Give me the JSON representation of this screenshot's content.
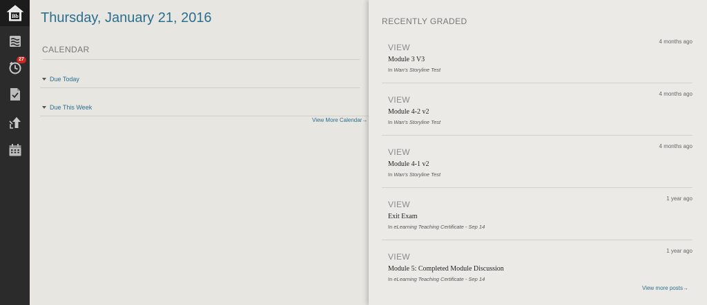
{
  "sidebar": {
    "badge_count": "27",
    "items": [
      {
        "icon": "blackboard-home-icon",
        "label": "Bb"
      },
      {
        "icon": "activity-stream-icon"
      },
      {
        "icon": "clock-icon"
      },
      {
        "icon": "grades-icon"
      },
      {
        "icon": "upload-icon"
      },
      {
        "icon": "calendar-icon"
      }
    ]
  },
  "left": {
    "date": "Thursday, January 21, 2016",
    "calendar_heading": "CALENDAR",
    "due_today": "Due Today",
    "due_this_week": "Due This Week",
    "view_more_calendar": "View More Calendar→"
  },
  "right": {
    "heading": "RECENTLY GRADED",
    "in_label": "In",
    "items": [
      {
        "action": "VIEW",
        "time": "4 months ago",
        "title": "Module 3 V3",
        "course": "Wan's Storyline Test"
      },
      {
        "action": "VIEW",
        "time": "4 months ago",
        "title": "Module 4-2 v2",
        "course": "Wan's Storyline Test"
      },
      {
        "action": "VIEW",
        "time": "4 months ago",
        "title": "Module 4-1 v2",
        "course": "Wan's Storyline Test"
      },
      {
        "action": "VIEW",
        "time": "1 year ago",
        "title": "Exit Exam",
        "course": "eLearning Teaching Certificate - Sep 14"
      },
      {
        "action": "VIEW",
        "time": "1 year ago",
        "title": "Module 5: Completed Module Discussion",
        "course": "eLearning Teaching Certificate - Sep 14"
      }
    ],
    "view_more_posts": "View more posts→"
  },
  "colors": {
    "accent": "#2a6f8e",
    "sidebar_bg": "#2b2b2b",
    "badge": "#c8261e"
  }
}
